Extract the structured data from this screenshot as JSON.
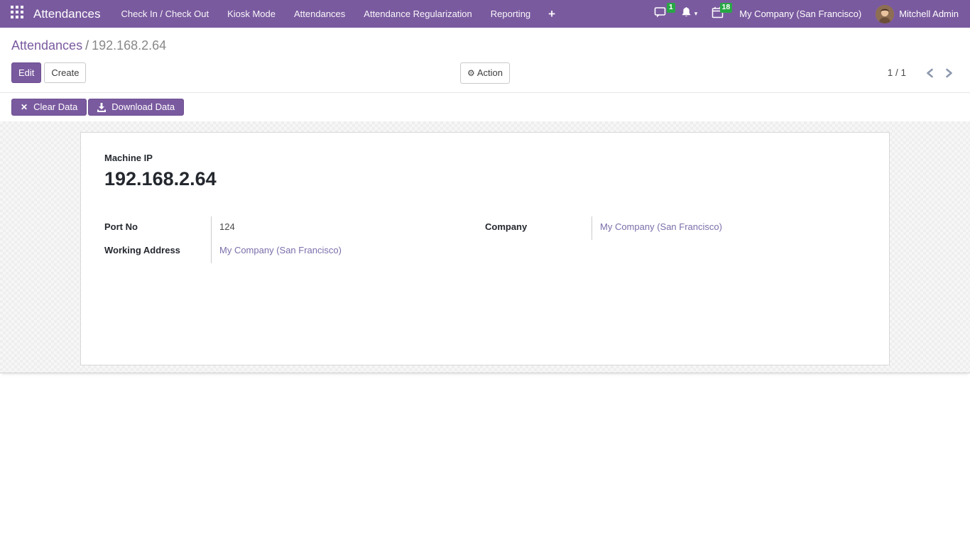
{
  "navbar": {
    "brand": "Attendances",
    "menu_items": [
      {
        "label": "Check In / Check Out"
      },
      {
        "label": "Kiosk Mode"
      },
      {
        "label": "Attendances"
      },
      {
        "label": "Attendance Regularization"
      },
      {
        "label": "Reporting"
      }
    ],
    "plus": "+",
    "messages_badge": "1",
    "calendar_badge": "18",
    "caret": "▾",
    "company": "My Company (San Francisco)",
    "user": "Mitchell Admin"
  },
  "breadcrumb": {
    "parent": "Attendances",
    "separator": "/",
    "current": "192.168.2.64"
  },
  "toolbar": {
    "edit_label": "Edit",
    "create_label": "Create",
    "action_label": "Action",
    "gear_glyph": "⚙"
  },
  "pager": {
    "value": "1 / 1"
  },
  "statusbar": {
    "clear_label": "Clear Data",
    "clear_glyph": "✕",
    "download_label": "Download Data"
  },
  "form": {
    "machine_ip_label": "Machine IP",
    "machine_ip_value": "192.168.2.64",
    "port_label": "Port No",
    "port_value": "124",
    "working_address_label": "Working Address",
    "working_address_value": "My Company (San Francisco)",
    "company_label": "Company",
    "company_value": "My Company (San Francisco)"
  },
  "colors": {
    "navbar_purple": "#7a5a9f",
    "badge_green": "#28a745",
    "link_purple": "#7c6eaa"
  }
}
